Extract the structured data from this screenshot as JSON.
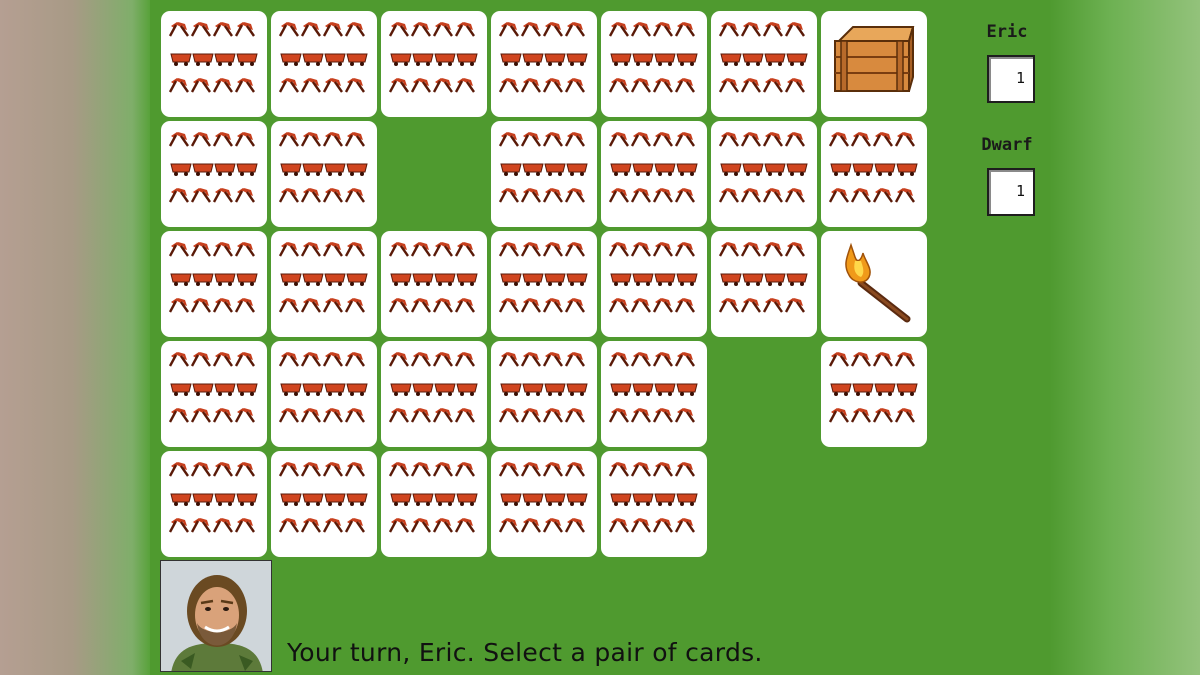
{
  "players": [
    {
      "name": "Eric",
      "score": "1"
    },
    {
      "name": "Dwarf",
      "score": "1"
    }
  ],
  "status_message": "Your turn, Eric. Select a pair of cards.",
  "cards": [
    {
      "row": 0,
      "col": 0,
      "face": "back"
    },
    {
      "row": 0,
      "col": 1,
      "face": "back"
    },
    {
      "row": 0,
      "col": 2,
      "face": "back"
    },
    {
      "row": 0,
      "col": 3,
      "face": "back"
    },
    {
      "row": 0,
      "col": 4,
      "face": "back"
    },
    {
      "row": 0,
      "col": 5,
      "face": "back"
    },
    {
      "row": 0,
      "col": 6,
      "face": "crate"
    },
    {
      "row": 1,
      "col": 0,
      "face": "back"
    },
    {
      "row": 1,
      "col": 1,
      "face": "back"
    },
    {
      "row": 1,
      "col": 3,
      "face": "back"
    },
    {
      "row": 1,
      "col": 4,
      "face": "back"
    },
    {
      "row": 1,
      "col": 5,
      "face": "back"
    },
    {
      "row": 1,
      "col": 6,
      "face": "back"
    },
    {
      "row": 2,
      "col": 0,
      "face": "back"
    },
    {
      "row": 2,
      "col": 1,
      "face": "back"
    },
    {
      "row": 2,
      "col": 2,
      "face": "back"
    },
    {
      "row": 2,
      "col": 3,
      "face": "back"
    },
    {
      "row": 2,
      "col": 4,
      "face": "back"
    },
    {
      "row": 2,
      "col": 5,
      "face": "back"
    },
    {
      "row": 2,
      "col": 6,
      "face": "torch"
    },
    {
      "row": 3,
      "col": 0,
      "face": "back"
    },
    {
      "row": 3,
      "col": 1,
      "face": "back"
    },
    {
      "row": 3,
      "col": 2,
      "face": "back"
    },
    {
      "row": 3,
      "col": 3,
      "face": "back"
    },
    {
      "row": 3,
      "col": 4,
      "face": "back"
    },
    {
      "row": 3,
      "col": 6,
      "face": "back"
    },
    {
      "row": 4,
      "col": 0,
      "face": "back"
    },
    {
      "row": 4,
      "col": 1,
      "face": "back"
    },
    {
      "row": 4,
      "col": 2,
      "face": "back"
    },
    {
      "row": 4,
      "col": 3,
      "face": "back"
    },
    {
      "row": 4,
      "col": 4,
      "face": "back"
    }
  ],
  "colors": {
    "table_green": "#4f9a2f",
    "card_white": "#ffffff",
    "card_pattern_red": "#c8401e",
    "card_pattern_dark": "#5a1a08"
  },
  "icons": {
    "card_back": "pickaxe-and-minecart-icon",
    "crate": "wooden-crate-icon",
    "torch": "torch-icon",
    "portrait": "player-portrait"
  }
}
